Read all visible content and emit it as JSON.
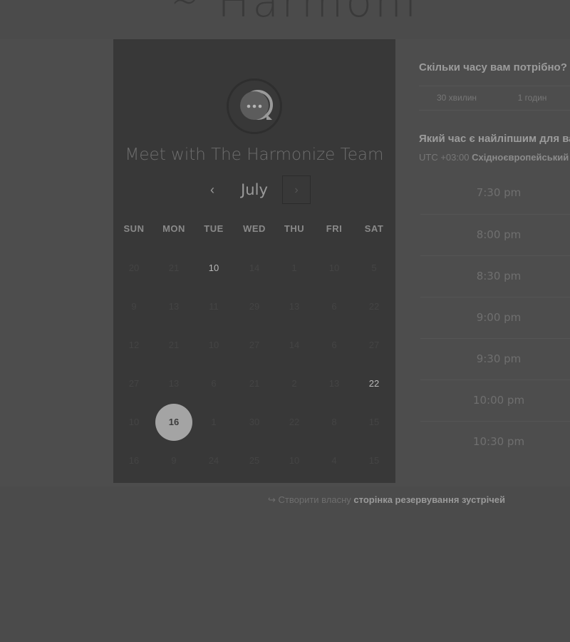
{
  "brand": {
    "logo_text": "Harmoni"
  },
  "calendar": {
    "title": "Meet with The Harmonize Team",
    "month": "July",
    "prev_icon": "‹",
    "next_icon": "›",
    "weekdays": [
      "SUN",
      "MON",
      "TUE",
      "WED",
      "THU",
      "FRI",
      "SAT"
    ],
    "weeks": [
      [
        "20",
        "21",
        "10",
        "14",
        "1",
        "10",
        "5"
      ],
      [
        "9",
        "13",
        "11",
        "29",
        "13",
        "6",
        "22"
      ],
      [
        "12",
        "21",
        "10",
        "27",
        "14",
        "6",
        "27"
      ],
      [
        "27",
        "13",
        "6",
        "21",
        "2",
        "13",
        "22"
      ],
      [
        "10",
        "16",
        "1",
        "30",
        "22",
        "8",
        "15"
      ],
      [
        "16",
        "9",
        "24",
        "25",
        "10",
        "4",
        "15"
      ]
    ],
    "active_days": [
      "0-2",
      "3-6"
    ],
    "selected_day": "4-1"
  },
  "duration": {
    "question": "Скільки часу вам потрібно?",
    "options": [
      "30 хвилин",
      "1 годин"
    ]
  },
  "time_pick": {
    "question": "Який час є найліпшим для вас?",
    "timezone_offset": "UTC +03:00",
    "timezone_name": "Східноєвропейський час",
    "slots": [
      "7:30 pm",
      "8:00 pm",
      "8:30 pm",
      "9:00 pm",
      "9:30 pm",
      "10:00 pm",
      "10:30 pm"
    ]
  },
  "footer": {
    "prefix": "Створити власну",
    "link": "сторінка резервування зустрічей",
    "icon": "pointer-icon"
  },
  "colors": {
    "card": "#383838",
    "background": "#4b4b4b",
    "selected": "#a4a4a4"
  }
}
